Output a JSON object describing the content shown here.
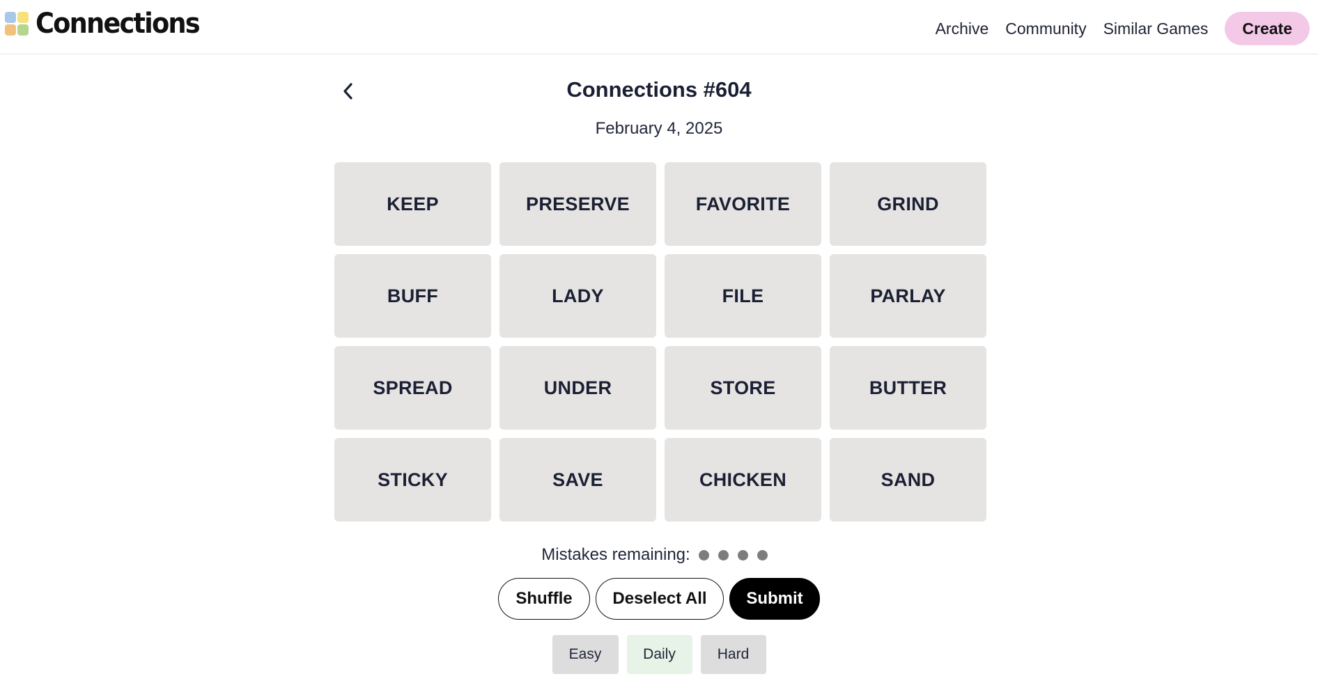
{
  "header": {
    "app_name": "Connections",
    "logo_colors": [
      "#a9c7e8",
      "#f5e27a",
      "#f2c17c",
      "#b5d68e"
    ],
    "nav": [
      {
        "label": "Archive"
      },
      {
        "label": "Community"
      },
      {
        "label": "Similar Games"
      }
    ],
    "create_label": "Create",
    "create_color": "#f4c9e8"
  },
  "puzzle": {
    "title": "Connections #604",
    "date": "February 4, 2025",
    "tiles": [
      "KEEP",
      "PRESERVE",
      "FAVORITE",
      "GRIND",
      "BUFF",
      "LADY",
      "FILE",
      "PARLAY",
      "SPREAD",
      "UNDER",
      "STORE",
      "BUTTER",
      "STICKY",
      "SAVE",
      "CHICKEN",
      "SAND"
    ],
    "tile_color": "#e5e4e2"
  },
  "status": {
    "mistakes_label": "Mistakes remaining:",
    "mistakes_remaining": 4
  },
  "actions": {
    "shuffle_label": "Shuffle",
    "deselect_label": "Deselect All",
    "submit_label": "Submit"
  },
  "modes": [
    {
      "label": "Easy",
      "color": "#dddddd"
    },
    {
      "label": "Daily",
      "color": "#e6f3e6"
    },
    {
      "label": "Hard",
      "color": "#dddddd"
    }
  ],
  "icons": {
    "back": "chevron-left-icon"
  }
}
